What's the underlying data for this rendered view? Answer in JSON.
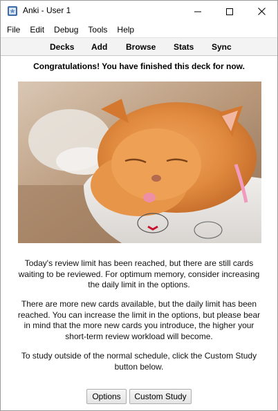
{
  "window": {
    "title": "Anki - User 1",
    "controls": {
      "minimize": "minimize",
      "maximize": "maximize",
      "close": "close"
    }
  },
  "menubar": [
    "File",
    "Edit",
    "Debug",
    "Tools",
    "Help"
  ],
  "toolbar": {
    "decks": "Decks",
    "add": "Add",
    "browse": "Browse",
    "stats": "Stats",
    "sync": "Sync"
  },
  "main": {
    "heading": "Congratulations! You have finished this deck for now.",
    "paragraphs": [
      "Today's review limit has been reached, but there are still cards waiting to be reviewed. For optimum memory, consider increasing the daily limit in the options.",
      "There are more new cards available, but the daily limit has been reached. You can increase the limit in the options, but please bear in mind that the more new cards you introduce, the higher your short-term review workload will become.",
      "To study outside of the normal schedule, click the Custom Study button below."
    ],
    "buttons": {
      "options": "Options",
      "custom_study": "Custom Study"
    }
  }
}
